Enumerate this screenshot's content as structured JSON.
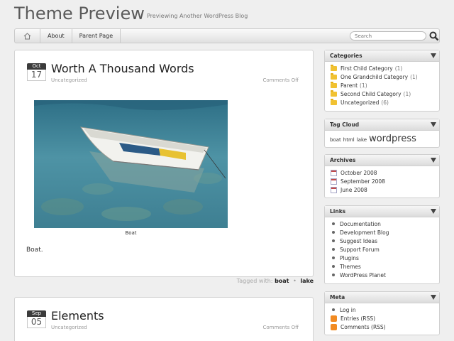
{
  "site": {
    "title": "Theme Preview",
    "tagline": "Previewing Another WordPress Blog"
  },
  "nav": {
    "items": [
      "About",
      "Parent Page"
    ],
    "search_placeholder": "Search"
  },
  "posts": [
    {
      "month": "Oct",
      "day": "17",
      "title": "Worth A Thousand Words",
      "category": "Uncategorized",
      "comments": "Comments Off",
      "image_caption": "Boat",
      "body": "Boat."
    },
    {
      "month": "Sep",
      "day": "05",
      "title": "Elements",
      "category": "Uncategorized",
      "comments": "Comments Off"
    }
  ],
  "tags_line": {
    "label": "Tagged with:",
    "tags": [
      "boat",
      "lake"
    ],
    "separator": "•"
  },
  "sidebar": {
    "categories": {
      "title": "Categories",
      "items": [
        {
          "label": "First Child Category",
          "count": "(1)"
        },
        {
          "label": "One Grandchild Category",
          "count": "(1)"
        },
        {
          "label": "Parent",
          "count": "(1)"
        },
        {
          "label": "Second Child Category",
          "count": "(1)"
        },
        {
          "label": "Uncategorized",
          "count": "(6)"
        }
      ]
    },
    "tagcloud": {
      "title": "Tag Cloud",
      "tags": [
        "boat",
        "html",
        "lake",
        "wordpress"
      ]
    },
    "archives": {
      "title": "Archives",
      "items": [
        "October 2008",
        "September 2008",
        "June 2008"
      ]
    },
    "links": {
      "title": "Links",
      "items": [
        "Documentation",
        "Development Blog",
        "Suggest Ideas",
        "Support Forum",
        "Plugins",
        "Themes",
        "WordPress Planet"
      ]
    },
    "meta": {
      "title": "Meta",
      "items": [
        "Log in",
        "Entries (RSS)",
        "Comments (RSS)"
      ]
    }
  },
  "colors": {
    "folder": "#f1c232",
    "rss": "#f28b22",
    "date_badge": "#3b3b3b"
  }
}
